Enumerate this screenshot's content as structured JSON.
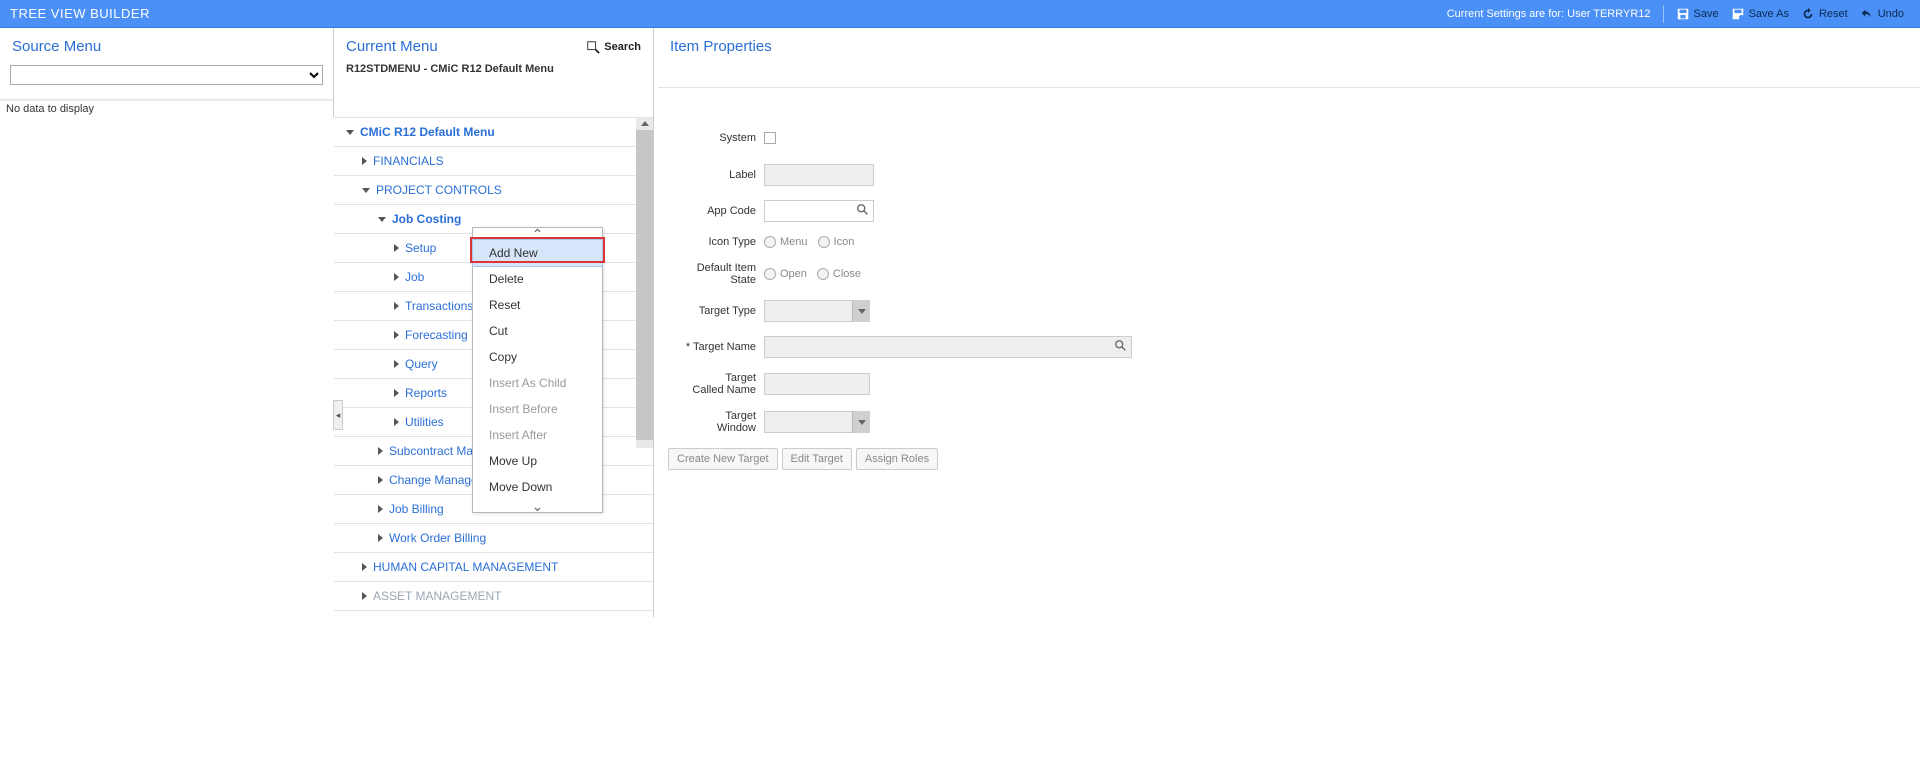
{
  "topbar": {
    "title": "TREE VIEW BUILDER",
    "settings_text": "Current Settings are for: User TERRYR12",
    "save": "Save",
    "save_as": "Save As",
    "reset": "Reset",
    "undo": "Undo"
  },
  "source": {
    "title": "Source Menu",
    "no_data": "No data to display"
  },
  "current": {
    "title": "Current Menu",
    "subtitle": "R12STDMENU - CMiC R12 Default Menu",
    "search": "Search"
  },
  "tree": {
    "root": "CMiC R12 Default Menu",
    "items": [
      {
        "label": "FINANCIALS",
        "state": "closed",
        "level": 1
      },
      {
        "label": "PROJECT CONTROLS",
        "state": "open",
        "level": 1
      },
      {
        "label": "Job Costing",
        "state": "open",
        "level": 2,
        "selected": true
      },
      {
        "label": "Setup",
        "state": "closed",
        "level": 3
      },
      {
        "label": "Job",
        "state": "closed",
        "level": 3
      },
      {
        "label": "Transactions",
        "state": "closed",
        "level": 3
      },
      {
        "label": "Forecasting",
        "state": "closed",
        "level": 3
      },
      {
        "label": "Query",
        "state": "closed",
        "level": 3
      },
      {
        "label": "Reports",
        "state": "closed",
        "level": 3
      },
      {
        "label": "Utilities",
        "state": "closed",
        "level": 3
      },
      {
        "label": "Subcontract Management",
        "state": "closed",
        "level": 2,
        "trunc": "Subcontract Mar"
      },
      {
        "label": "Change Management",
        "state": "closed",
        "level": 2,
        "trunc": "Change Manage"
      },
      {
        "label": "Job Billing",
        "state": "closed",
        "level": 2
      },
      {
        "label": "Work Order Billing",
        "state": "closed",
        "level": 2
      },
      {
        "label": "HUMAN CAPITAL MANAGEMENT",
        "state": "closed",
        "level": 1
      },
      {
        "label": "ASSET MANAGEMENT",
        "state": "closed",
        "level": 1,
        "muted": true
      }
    ]
  },
  "context_menu": {
    "items": [
      {
        "label": "Add New",
        "highlight": true
      },
      {
        "label": "Delete"
      },
      {
        "label": "Reset"
      },
      {
        "label": "Cut"
      },
      {
        "label": "Copy"
      },
      {
        "label": "Insert As Child",
        "disabled": true
      },
      {
        "label": "Insert Before",
        "disabled": true
      },
      {
        "label": "Insert After",
        "disabled": true
      },
      {
        "label": "Move Up"
      },
      {
        "label": "Move Down"
      }
    ]
  },
  "props": {
    "title": "Item Properties",
    "labels": {
      "system": "System",
      "label": "Label",
      "app_code": "App Code",
      "icon_type": "Icon Type",
      "default_item_state": "Default Item\nState",
      "target_type": "Target Type",
      "target_name": "Target Name",
      "target_called_name": "Target\nCalled Name",
      "target_window": "Target\nWindow"
    },
    "radios": {
      "menu": "Menu",
      "icon": "Icon",
      "open": "Open",
      "close": "Close"
    },
    "buttons": {
      "create": "Create New Target",
      "edit": "Edit Target",
      "assign": "Assign Roles"
    }
  }
}
